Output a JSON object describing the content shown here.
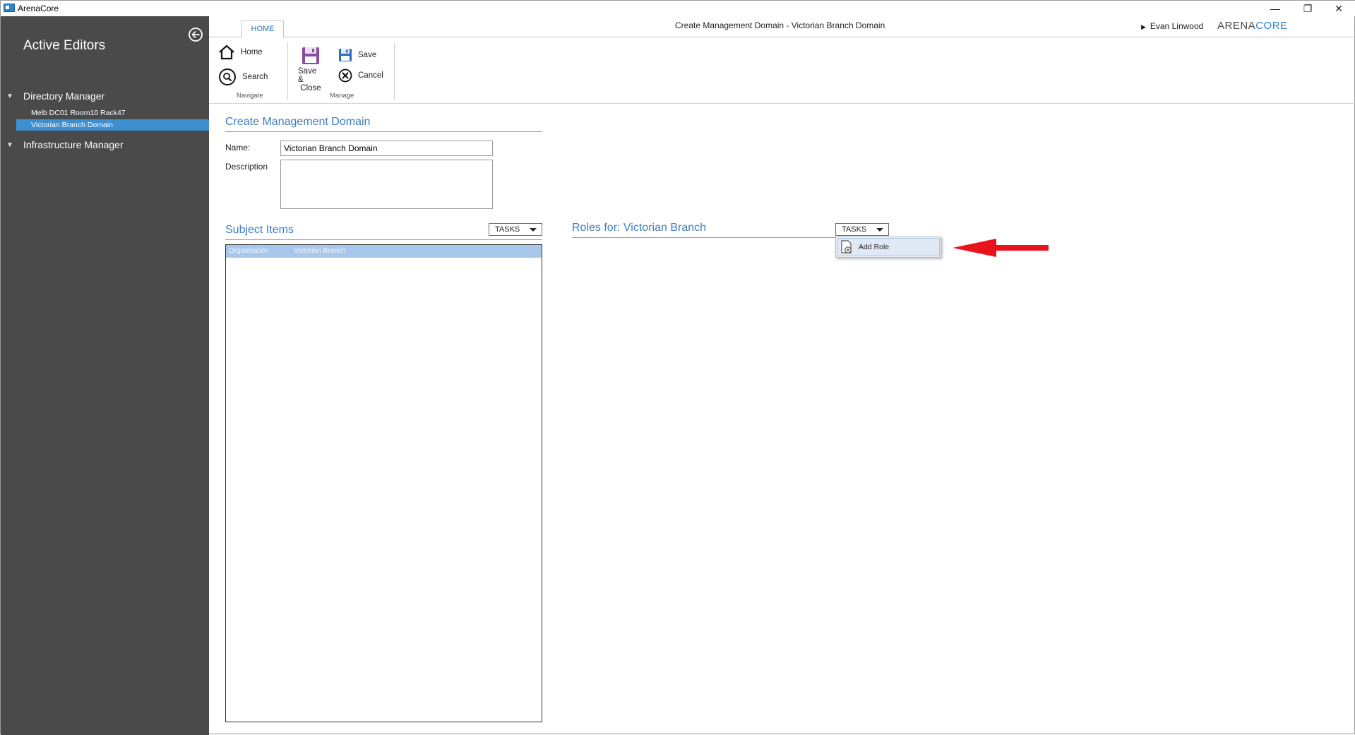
{
  "window": {
    "app_title": "ArenaCore",
    "minimize_glyph": "—",
    "restore_glyph": "❐",
    "close_glyph": "✕"
  },
  "sidebar": {
    "title": "Active Editors",
    "groups": [
      {
        "label": "Directory Manager",
        "items": [
          {
            "label": "Melb DC01 Room10 Rack47",
            "active": false
          },
          {
            "label": "Victorian Branch Domain",
            "active": true
          }
        ]
      },
      {
        "label": "Infrastructure Manager",
        "items": []
      }
    ]
  },
  "header": {
    "tab": "HOME",
    "window_heading": "Create Management Domain - Victorian Branch Domain",
    "user": "Evan Linwood",
    "brand_part1": "ARENA",
    "brand_part2": "CORE"
  },
  "ribbon": {
    "navigate": {
      "home": "Home",
      "search": "Search",
      "label": "Navigate"
    },
    "manage": {
      "save_close_line1": "Save &",
      "save_close_line2": "Close",
      "save": "Save",
      "cancel": "Cancel",
      "label": "Manage"
    }
  },
  "form": {
    "title": "Create Management Domain",
    "name_label": "Name:",
    "name_value": "Victorian Branch Domain",
    "description_label": "Description",
    "description_value": ""
  },
  "subject_items": {
    "title": "Subject Items",
    "tasks_label": "TASKS",
    "columns": [
      "Organisation",
      "Victorian Branch"
    ]
  },
  "roles": {
    "title": "Roles for: Victorian Branch",
    "tasks_label": "TASKS",
    "menu_items": [
      "Add Role"
    ]
  },
  "colors": {
    "sidebar_bg": "#4a4a4a",
    "active_item": "#3d8fd0",
    "accent_text": "#3d7fc0",
    "annotation_arrow": "#e8141c"
  }
}
